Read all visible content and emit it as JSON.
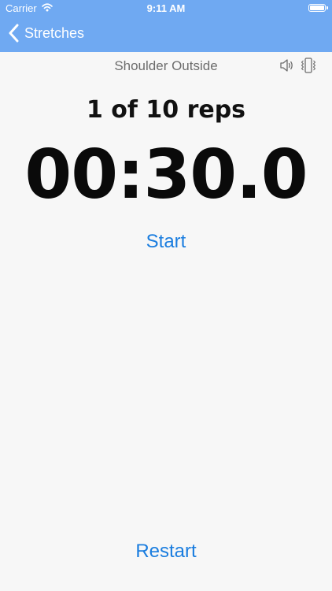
{
  "status_bar": {
    "carrier": "Carrier",
    "time": "9:11 AM",
    "wifi_icon": "wifi-icon",
    "battery_icon": "battery-icon"
  },
  "nav": {
    "back_label": "Stretches",
    "back_icon": "chevron-left-icon"
  },
  "exercise": {
    "name": "Shoulder Outside",
    "sound_icon": "speaker-icon",
    "vibrate_icon": "vibrate-icon"
  },
  "counter": {
    "reps_text": "1 of 10 reps",
    "timer": "00:30.0"
  },
  "actions": {
    "start_label": "Start",
    "restart_label": "Restart"
  },
  "colors": {
    "nav_bar": "#6fa9f2",
    "accent": "#1a7ddf",
    "background": "#f7f7f7",
    "title_text": "#6d6d6d",
    "timer_text": "#0a0a0a"
  }
}
